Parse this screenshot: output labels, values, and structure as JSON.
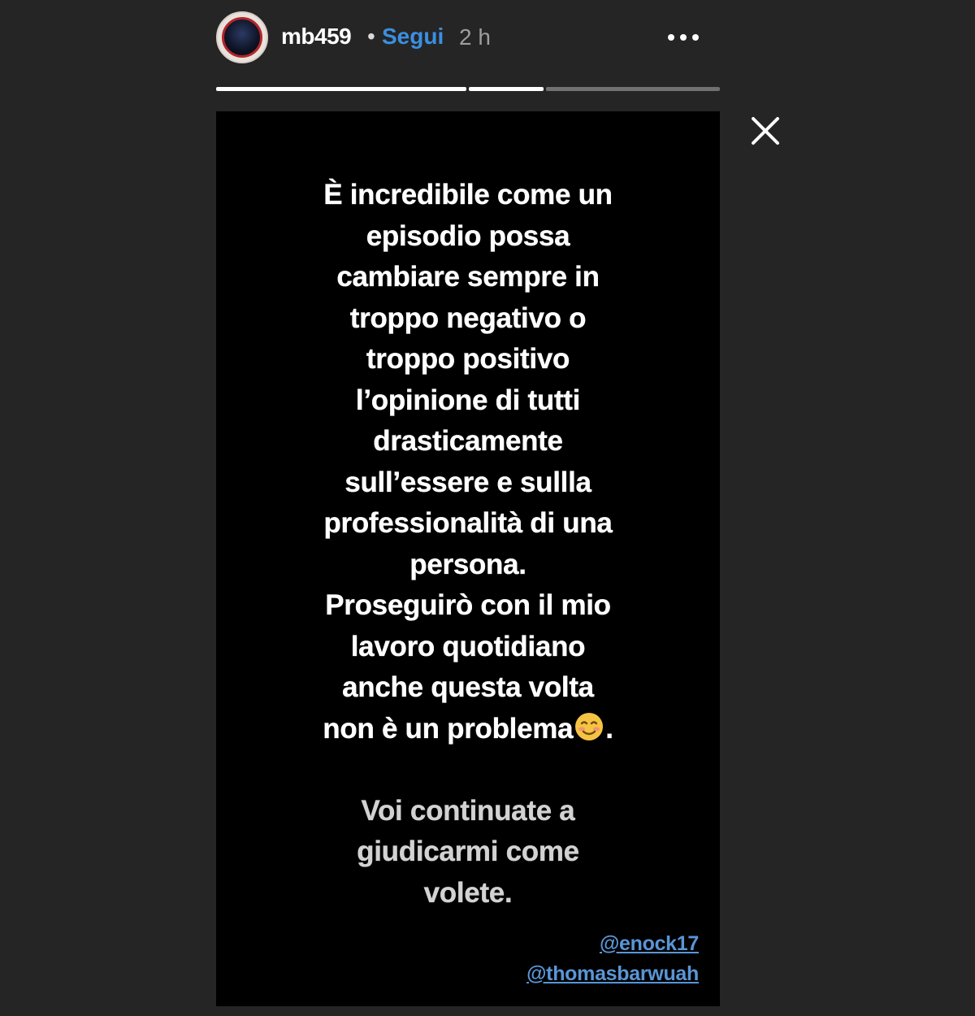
{
  "header": {
    "username": "mb459",
    "separator": "•",
    "follow_label": "Segui",
    "time": "2 h",
    "more_icon": "more-horizontal-icon"
  },
  "progress": {
    "segments": [
      {
        "filled": 1.0
      },
      {
        "filled": 1.0
      },
      {
        "filled": 0.0
      }
    ]
  },
  "close_icon": "close-icon",
  "story": {
    "lines_1": [
      "È incredibile come un",
      "episodio possa",
      "cambiare sempre in",
      "troppo negativo o",
      "troppo positivo",
      "l’opinione di tutti",
      "drasticamente",
      "sull’essere e sullla",
      "professionalità di una",
      "persona.",
      "Proseguirò con il mio",
      "lavoro quotidiano",
      "anche questa volta"
    ],
    "emoji_line_before": "non è un problema",
    "emoji_name": "smiling-face-emoji",
    "emoji_line_after": ".",
    "lines_2": [
      "Voi continuate a",
      "giudicarmi come",
      "volete."
    ],
    "mentions": [
      "@enock17",
      "@thomasbarwuah"
    ]
  },
  "colors": {
    "background": "#252525",
    "story_bg": "#000000",
    "follow": "#3b8fe0",
    "mention": "#5a95d6"
  }
}
